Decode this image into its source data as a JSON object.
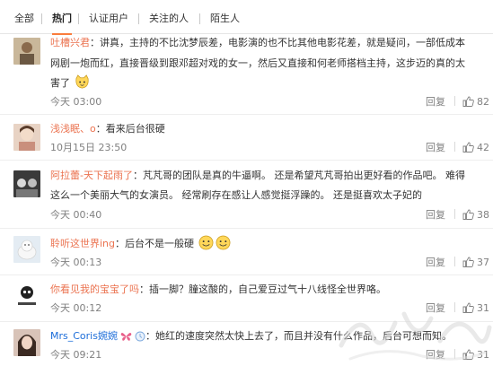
{
  "tabs": [
    {
      "label": "全部"
    },
    {
      "label": "热门"
    },
    {
      "label": "认证用户"
    },
    {
      "label": "关注的人"
    },
    {
      "label": "陌生人"
    }
  ],
  "reply_label": "回复",
  "comments": [
    {
      "username": "吐槽兴君",
      "text_lines": [
        "讲真，主持的不比沈梦辰差，电影演的也不比其他电影花差，就是疑问，一部低成本",
        "网剧一炮而红，直接晋级到跟邓超对戏的女一，然后又直接和何老师搭档主持，这步迈的真的太",
        "害了"
      ],
      "time": "今天 03:00",
      "likes": "82"
    },
    {
      "username": "浅浅眠、o",
      "text_lines": [
        "看来后台很硬"
      ],
      "time": "10月15日 23:50",
      "likes": "42"
    },
    {
      "username": "阿拉蕾-天下起雨了",
      "text_lines": [
        "芃芃哥的团队是真的牛逼啊。 还是希望芃芃哥拍出更好看的作品吧。 难得",
        "这么一个美丽大气的女演员。 经常刷存在感让人感觉挺浮躁的。 还是挺喜欢太子妃的"
      ],
      "time": "今天 00:40",
      "likes": "38"
    },
    {
      "username": "聆听这世界ing",
      "text_lines": [
        "后台不是一般硬"
      ],
      "time": "今天 00:13",
      "likes": "37"
    },
    {
      "username": "你看见我的宝宝了吗",
      "text_lines": [
        "插一脚？膧这酸的，自己爱豆过气十八线怪全世界咯。"
      ],
      "time": "今天 00:12",
      "likes": "31"
    },
    {
      "username": "Mrs_Coris婉婉",
      "text_lines": [
        "她红的速度突然太快上去了，而且并没有什么作品，后台可想而知。"
      ],
      "time": "今天 09:21",
      "likes": "31"
    }
  ],
  "colors": {
    "accent": "#fa7d3c",
    "username": "#eb7350",
    "username_alt": "#1c6dd9",
    "meta": "#808080"
  },
  "icons": {
    "like": "thumbs-up-icon",
    "emoji": "smiley-face-icon",
    "butterfly": "butterfly-icon",
    "clock": "clock-icon"
  }
}
